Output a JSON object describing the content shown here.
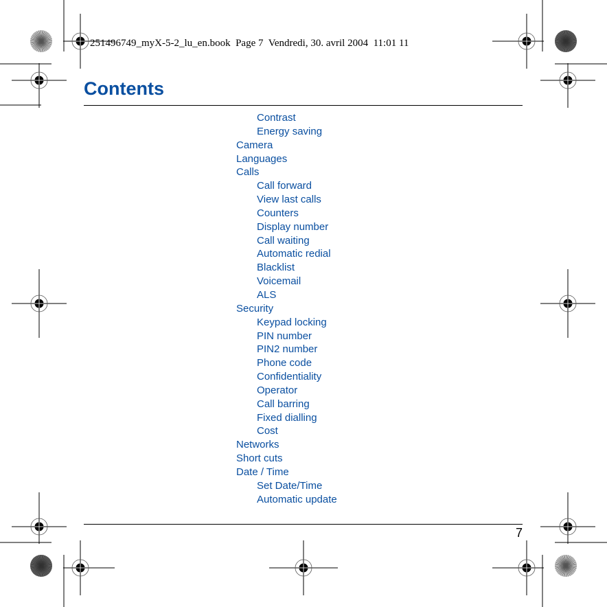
{
  "header": {
    "print_info": "251496749_myX-5-2_lu_en.book  Page 7  Vendredi, 30. avril 2004  11:01 11"
  },
  "page": {
    "title": "Contents",
    "number": "7"
  },
  "toc": [
    {
      "label": "Contrast",
      "level": 2
    },
    {
      "label": "Energy saving",
      "level": 2
    },
    {
      "label": "Camera",
      "level": 1
    },
    {
      "label": "Languages",
      "level": 1
    },
    {
      "label": "Calls",
      "level": 1
    },
    {
      "label": "Call forward",
      "level": 2
    },
    {
      "label": "View last calls",
      "level": 2
    },
    {
      "label": "Counters",
      "level": 2
    },
    {
      "label": "Display number",
      "level": 2
    },
    {
      "label": "Call waiting",
      "level": 2
    },
    {
      "label": "Automatic redial",
      "level": 2
    },
    {
      "label": "Blacklist",
      "level": 2
    },
    {
      "label": "Voicemail",
      "level": 2
    },
    {
      "label": "ALS",
      "level": 2
    },
    {
      "label": "Security",
      "level": 1
    },
    {
      "label": "Keypad locking",
      "level": 2
    },
    {
      "label": "PIN number",
      "level": 2
    },
    {
      "label": "PIN2 number",
      "level": 2
    },
    {
      "label": "Phone code",
      "level": 2
    },
    {
      "label": "Confidentiality",
      "level": 2
    },
    {
      "label": "Operator",
      "level": 2
    },
    {
      "label": "Call barring",
      "level": 2
    },
    {
      "label": "Fixed dialling",
      "level": 2
    },
    {
      "label": "Cost",
      "level": 2
    },
    {
      "label": "Networks",
      "level": 1
    },
    {
      "label": "Short cuts",
      "level": 1
    },
    {
      "label": "Date / Time",
      "level": 1
    },
    {
      "label": "Set Date/Time",
      "level": 2
    },
    {
      "label": "Automatic update",
      "level": 2
    }
  ],
  "colors": {
    "accent": "#0a4fa0",
    "text": "#000000"
  }
}
